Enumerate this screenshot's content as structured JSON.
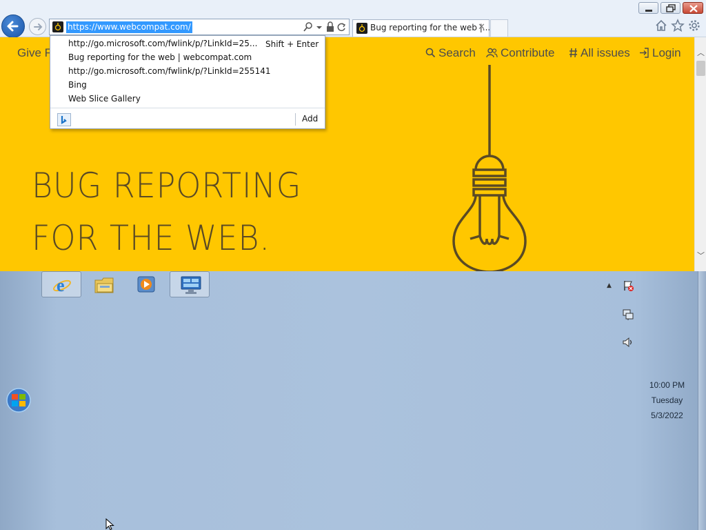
{
  "browser": {
    "url": "https://www.webcompat.com/",
    "tab": {
      "title": "Bug reporting for the web |..."
    }
  },
  "autocomplete": {
    "items": [
      "http://go.microsoft.com/fwlink/p/?LinkId=25...",
      "Bug reporting for the web | webcompat.com",
      "http://go.microsoft.com/fwlink/p/?LinkId=255141",
      "Bing",
      "Web Slice Gallery"
    ],
    "shortcut": "Shift + Enter",
    "add_label": "Add",
    "provider_icon": "bing-icon"
  },
  "page": {
    "nav": {
      "partial": "Give F",
      "search": "Search",
      "contribute": "Contribute",
      "all_issues": "All issues",
      "login": "Login"
    },
    "hero": {
      "line1": "BUG REPORTING",
      "line2": "FOR THE WEB."
    },
    "background_color": "#ffc700",
    "text_color": "#5a4a24"
  },
  "taskbar": {
    "buttons": [
      "internet-explorer",
      "windows-explorer",
      "media-player",
      "remote-desktop"
    ],
    "clock": {
      "time": "10:00 PM",
      "day": "Tuesday",
      "date": "5/3/2022"
    }
  }
}
